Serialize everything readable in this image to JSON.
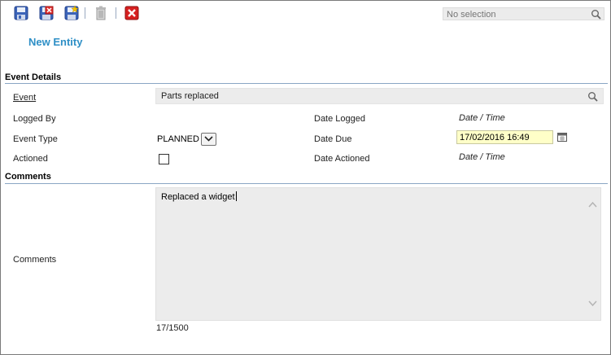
{
  "toolbar": {
    "buttons": [
      {
        "icon": "save-icon"
      },
      {
        "icon": "save-close-icon"
      },
      {
        "icon": "save-new-icon"
      },
      {
        "icon": "delete-icon"
      },
      {
        "icon": "close-icon"
      }
    ],
    "search_placeholder": "No selection"
  },
  "entity": {
    "title": "New Entity"
  },
  "sections": {
    "event_details": "Event Details",
    "comments": "Comments"
  },
  "fields": {
    "event_label": "Event",
    "event_value": "Parts replaced",
    "logged_by_label": "Logged By",
    "event_type_label": "Event Type",
    "event_type_value": "PLANNED",
    "actioned_label": "Actioned",
    "actioned_checked": false,
    "date_logged_label": "Date Logged",
    "date_logged_value": "Date / Time",
    "date_due_label": "Date Due",
    "date_due_value": "17/02/2016 16:49",
    "date_actioned_label": "Date Actioned",
    "date_actioned_value": "Date / Time",
    "comments_label": "Comments",
    "comments_value": "Replaced a widget",
    "comments_counter": "17/1500"
  },
  "colors": {
    "accent": "#2e8fc6",
    "section_line": "#8aa6c4",
    "input_bg": "#ececec",
    "date_highlight": "#ffffc8"
  }
}
